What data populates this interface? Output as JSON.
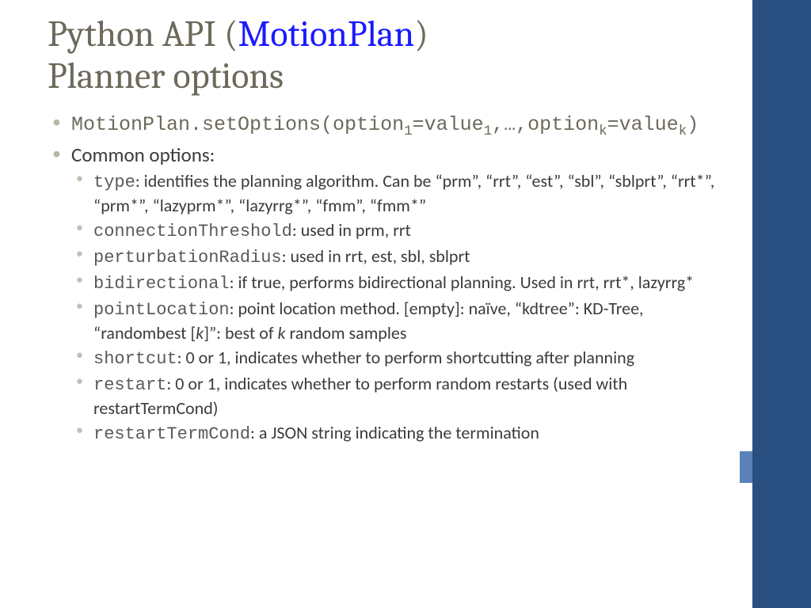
{
  "title": {
    "pre": "Python API (",
    "link": "MotionPlan",
    "post": ")",
    "line2": "Planner options"
  },
  "bullets": {
    "set_options_pre": "MotionPlan.setOptions(option",
    "set_options_mid1": "=value",
    "set_options_mid2": ",…,option",
    "set_options_mid3": "=value",
    "set_options_end": ")",
    "common_label": "Common options:",
    "opts": {
      "type_code": "type",
      "type_rest": ": identifies the planning algorithm. Can be “prm”, “rrt”, “est”, “sbl”, “sblprt”, “rrt*”, “prm*”, “lazyprm*”, “lazyrrg*”, “fmm”, “fmm*”",
      "conn_code": "connectionThreshold",
      "conn_rest": ": used in prm, rrt",
      "pert_code": "perturbationRadius",
      "pert_rest": ": used in rrt, est, sbl, sblprt",
      "bidi_code": "bidirectional",
      "bidi_rest": ": if true, performs bidirectional planning. Used in rrt, rrt*, lazyrrg*",
      "pl_code": "pointLocation",
      "pl_rest1": ": point location method. [empty]: naïve, “kdtree”: KD-Tree, “randombest [",
      "pl_k1": "k",
      "pl_rest2": "]”: best of ",
      "pl_k2": "k",
      "pl_rest3": " random samples",
      "sc_code": "shortcut",
      "sc_rest": ": 0 or 1, indicates whether to perform shortcutting after planning",
      "rs_code": "restart",
      "rs_rest": ": 0 or 1, indicates whether to perform random restarts (used with restartTermCond)",
      "rtc_code": "restartTermCond",
      "rtc_rest": ": a JSON string indicating the termination"
    }
  }
}
